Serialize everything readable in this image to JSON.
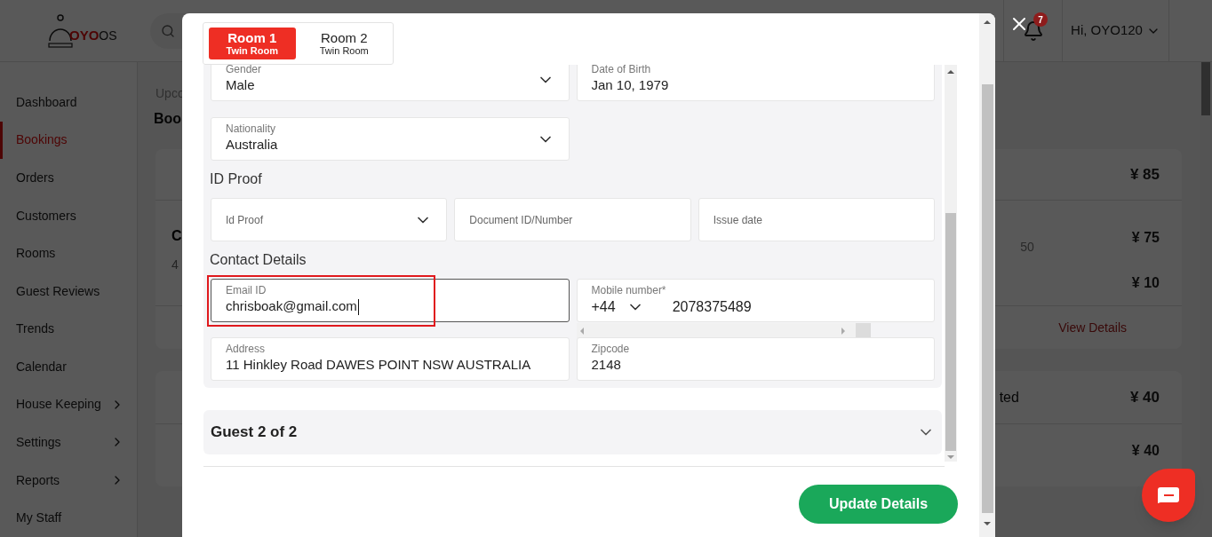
{
  "header": {
    "logo_brand": "OYO",
    "logo_suffix": "OS",
    "notification_count": "7",
    "user_menu": "Hi, OYO120"
  },
  "sidebar": {
    "items": [
      {
        "label": "Dashboard",
        "selected": false,
        "has_submenu": false
      },
      {
        "label": "Bookings",
        "selected": true,
        "has_submenu": false
      },
      {
        "label": "Orders",
        "selected": false,
        "has_submenu": false
      },
      {
        "label": "Customers",
        "selected": false,
        "has_submenu": false
      },
      {
        "label": "Rooms",
        "selected": false,
        "has_submenu": false
      },
      {
        "label": "Guest Reviews",
        "selected": false,
        "has_submenu": false
      },
      {
        "label": "Trends",
        "selected": false,
        "has_submenu": false
      },
      {
        "label": "Calendar",
        "selected": false,
        "has_submenu": false
      },
      {
        "label": "House Keeping",
        "selected": false,
        "has_submenu": true
      },
      {
        "label": "Settings",
        "selected": false,
        "has_submenu": true
      },
      {
        "label": "Reports",
        "selected": false,
        "has_submenu": true
      },
      {
        "label": "My Staff",
        "selected": false,
        "has_submenu": false
      }
    ]
  },
  "background": {
    "breadcrumb": "Upco",
    "title": "Boo",
    "card_1": {
      "header_price": "¥ 85",
      "left_lines": [
        "C",
        "4"
      ],
      "middle_text": "50",
      "prices": [
        "¥ 75",
        "¥ 10"
      ],
      "link": "View Details"
    },
    "card_2": {
      "header_text": "ted",
      "header_price": "¥ 40",
      "price": "¥ 40"
    }
  },
  "modal": {
    "tabs": [
      {
        "title": "Room 1",
        "subtitle": "Twin Room",
        "selected": true
      },
      {
        "title": "Room 2",
        "subtitle": "Twin Room",
        "selected": false
      }
    ],
    "sections": [
      {
        "kind": "fields",
        "fields": [
          {
            "kind": "select",
            "label": "Gender",
            "value": "Male"
          },
          {
            "kind": "text",
            "label": "Date of Birth",
            "value": "Jan 10, 1979"
          }
        ]
      },
      {
        "kind": "fields",
        "fields": [
          {
            "kind": "select",
            "label": "Nationality",
            "value": "Australia"
          }
        ]
      },
      {
        "kind": "heading",
        "text": "ID Proof"
      },
      {
        "kind": "fields",
        "fields": [
          {
            "kind": "select",
            "placeholder": "Id Proof"
          },
          {
            "kind": "text",
            "placeholder": "Document ID/Number"
          },
          {
            "kind": "text",
            "placeholder": "Issue date"
          }
        ]
      },
      {
        "kind": "heading",
        "text": "Contact Details"
      },
      {
        "kind": "fields",
        "fields": [
          {
            "kind": "text",
            "label": "Email ID",
            "value": "chrisboak@gmail.com",
            "focused": true,
            "highlighted": true
          },
          {
            "kind": "phone",
            "label": "Mobile number*",
            "code": "+44",
            "value": "2078375489",
            "focused": false,
            "highlighted": false
          }
        ]
      },
      {
        "kind": "fields",
        "fields": [
          {
            "kind": "text",
            "label": "Address",
            "value": "11 Hinkley Road DAWES POINT NSW AUSTRALIA"
          },
          {
            "kind": "text",
            "label": "Zipcode",
            "value": "2148"
          }
        ]
      }
    ],
    "collapsed_guest": {
      "title": "Guest 2 of 2",
      "expanded": false
    },
    "submit_button": "Update Details"
  }
}
